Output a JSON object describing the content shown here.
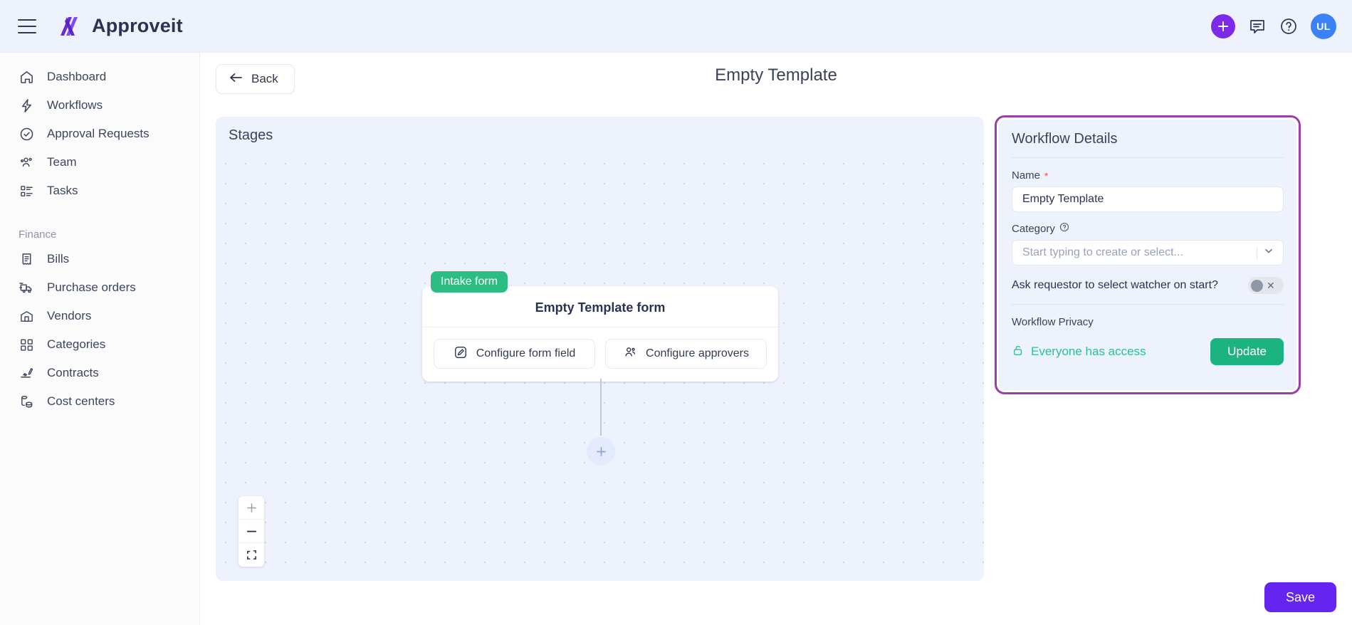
{
  "app": {
    "brand_name": "Approveit",
    "menu_icon": "hamburger-icon",
    "logo_icon": "approveit-logo-icon"
  },
  "topbar": {
    "add_icon": "plus-icon",
    "chat_icon": "chat-bubble-icon",
    "help_icon": "question-circle-icon",
    "avatar_initials": "UL"
  },
  "sidebar": {
    "items": [
      {
        "label": "Dashboard",
        "icon": "home-icon"
      },
      {
        "label": "Workflows",
        "icon": "lightning-bolt-icon"
      },
      {
        "label": "Approval Requests",
        "icon": "check-circle-icon"
      },
      {
        "label": "Team",
        "icon": "users-icon"
      },
      {
        "label": "Tasks",
        "icon": "task-list-icon"
      }
    ],
    "section_label": "Finance",
    "finance_items": [
      {
        "label": "Bills",
        "icon": "receipt-icon"
      },
      {
        "label": "Purchase orders",
        "icon": "truck-icon"
      },
      {
        "label": "Vendors",
        "icon": "warehouse-icon"
      },
      {
        "label": "Categories",
        "icon": "grid-icon"
      },
      {
        "label": "Contracts",
        "icon": "contract-pen-icon"
      },
      {
        "label": "Cost centers",
        "icon": "coins-icon"
      }
    ]
  },
  "page": {
    "back_label": "Back",
    "back_icon": "arrow-left-icon",
    "title": "Empty Template"
  },
  "canvas": {
    "header": "Stages",
    "node": {
      "badge": "Intake form",
      "title": "Empty Template form",
      "buttons": [
        {
          "label": "Configure form field",
          "icon": "form-edit-icon"
        },
        {
          "label": "Configure approvers",
          "icon": "approvers-icon"
        }
      ]
    },
    "add_node_icon": "plus-icon",
    "zoom_controls": [
      {
        "name": "zoom-in",
        "glyph": "+"
      },
      {
        "name": "zoom-out",
        "glyph": "−"
      },
      {
        "name": "fit-view",
        "glyph": "fit-screen-icon"
      }
    ]
  },
  "details": {
    "title": "Workflow Details",
    "name_label": "Name",
    "name_required_mark": "*",
    "name_value": "Empty Template",
    "category_label": "Category",
    "category_help_icon": "question-circle-icon",
    "category_placeholder": "Start typing to create or select...",
    "category_caret_icon": "chevron-down-icon",
    "watcher_label": "Ask requestor to select watcher on start?",
    "watcher_toggle_state": "off",
    "watcher_toggle_glyph": "✕",
    "privacy_label": "Workflow Privacy",
    "privacy_value": "Everyone has access",
    "privacy_icon": "unlock-icon",
    "update_label": "Update",
    "highlight_color": "#9b3fa8"
  },
  "footer": {
    "save_label": "Save",
    "save_color": "#6425f0"
  }
}
